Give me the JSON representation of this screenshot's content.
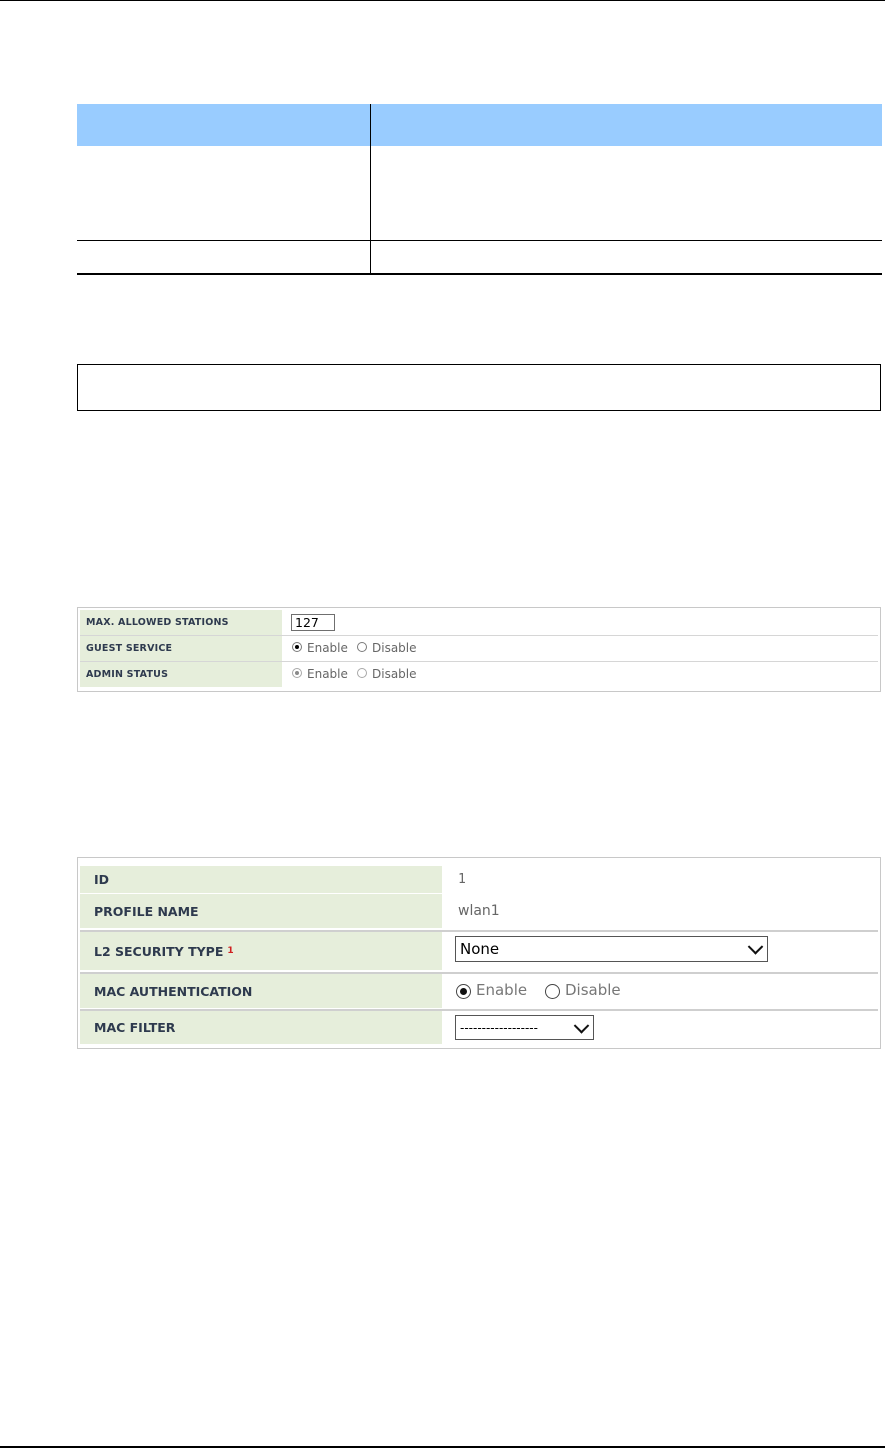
{
  "panel1": {
    "rows": [
      {
        "label": "MAX. ALLOWED STATIONS",
        "value": "127"
      },
      {
        "label": "GUEST SERVICE",
        "options": [
          "Enable",
          "Disable"
        ],
        "selected": "Enable",
        "enabled": true
      },
      {
        "label": "ADMIN STATUS",
        "options": [
          "Enable",
          "Disable"
        ],
        "selected": "Enable",
        "enabled": false
      }
    ]
  },
  "panel2": {
    "id": {
      "label": "ID",
      "value": "1"
    },
    "profile_name": {
      "label": "PROFILE NAME",
      "value": "wlan1"
    },
    "l2_security": {
      "label": "L2 SECURITY TYPE",
      "footnote": "1",
      "value": "None"
    },
    "mac_auth": {
      "label": "MAC AUTHENTICATION",
      "options": [
        "Enable",
        "Disable"
      ],
      "selected": "Enable"
    },
    "mac_filter": {
      "label": "MAC FILTER",
      "value": "------------------"
    }
  }
}
